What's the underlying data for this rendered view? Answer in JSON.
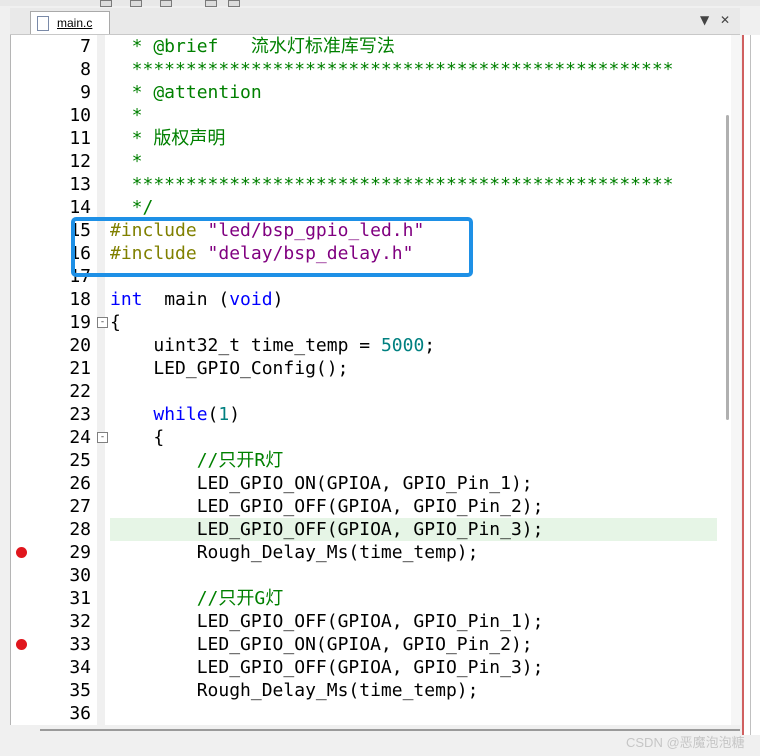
{
  "tab": {
    "filename": "main.c"
  },
  "tab_controls": {
    "dropdown": "▼",
    "close": "✕"
  },
  "watermark": "CSDN @恶魔泡泡糖",
  "lines": [
    {
      "n": "7",
      "segs": [
        [
          "cm",
          "  * @brief   流水灯标准库写法"
        ]
      ]
    },
    {
      "n": "8",
      "segs": [
        [
          "cm",
          "  **************************************************"
        ]
      ]
    },
    {
      "n": "9",
      "segs": [
        [
          "cm",
          "  * @attention"
        ]
      ]
    },
    {
      "n": "10",
      "segs": [
        [
          "cm",
          "  *"
        ]
      ]
    },
    {
      "n": "11",
      "segs": [
        [
          "cm",
          "  * 版权声明"
        ]
      ]
    },
    {
      "n": "12",
      "segs": [
        [
          "cm",
          "  *"
        ]
      ]
    },
    {
      "n": "13",
      "segs": [
        [
          "cm",
          "  **************************************************"
        ]
      ]
    },
    {
      "n": "14",
      "segs": [
        [
          "cm",
          "  */"
        ]
      ]
    },
    {
      "n": "15",
      "segs": [
        [
          "pp",
          "#include "
        ],
        [
          "str",
          "\"led/bsp_gpio_led.h\""
        ]
      ]
    },
    {
      "n": "16",
      "segs": [
        [
          "pp",
          "#include "
        ],
        [
          "str",
          "\"delay/bsp_delay.h\""
        ]
      ]
    },
    {
      "n": "17",
      "segs": []
    },
    {
      "n": "18",
      "segs": [
        [
          "kw",
          "int"
        ],
        [
          "",
          "  main ("
        ],
        [
          "kw",
          "void"
        ],
        [
          "",
          ")"
        ]
      ]
    },
    {
      "n": "19",
      "segs": [
        [
          "",
          "{"
        ]
      ],
      "fold": "-"
    },
    {
      "n": "20",
      "segs": [
        [
          "",
          "    uint32_t time_temp = "
        ],
        [
          "num",
          "5000"
        ],
        [
          "",
          ";"
        ]
      ]
    },
    {
      "n": "21",
      "segs": [
        [
          "",
          "    LED_GPIO_Config();"
        ]
      ]
    },
    {
      "n": "22",
      "segs": []
    },
    {
      "n": "23",
      "segs": [
        [
          "",
          "    "
        ],
        [
          "kw",
          "while"
        ],
        [
          "",
          "("
        ],
        [
          "num",
          "1"
        ],
        [
          "",
          ")"
        ]
      ]
    },
    {
      "n": "24",
      "segs": [
        [
          "",
          "    {"
        ]
      ],
      "fold": "-"
    },
    {
      "n": "25",
      "segs": [
        [
          "",
          "        "
        ],
        [
          "cm",
          "//只开R灯"
        ]
      ]
    },
    {
      "n": "26",
      "segs": [
        [
          "",
          "        LED_GPIO_ON(GPIOA, GPIO_Pin_1);"
        ]
      ]
    },
    {
      "n": "27",
      "segs": [
        [
          "",
          "        LED_GPIO_OFF(GPIOA, GPIO_Pin_2);"
        ]
      ]
    },
    {
      "n": "28",
      "segs": [
        [
          "",
          "        LED_GPIO_OFF(GPIOA, GPIO_Pin_3);"
        ]
      ],
      "current": true
    },
    {
      "n": "29",
      "segs": [
        [
          "",
          "        Rough_Delay_Ms(time_temp);"
        ]
      ],
      "breakpoint": true
    },
    {
      "n": "30",
      "segs": []
    },
    {
      "n": "31",
      "segs": [
        [
          "",
          "        "
        ],
        [
          "cm",
          "//只开G灯"
        ]
      ]
    },
    {
      "n": "32",
      "segs": [
        [
          "",
          "        LED_GPIO_OFF(GPIOA, GPIO_Pin_1);"
        ]
      ]
    },
    {
      "n": "33",
      "segs": [
        [
          "",
          "        LED_GPIO_ON(GPIOA, GPIO_Pin_2);"
        ]
      ],
      "breakpoint": true
    },
    {
      "n": "34",
      "segs": [
        [
          "",
          "        LED_GPIO_OFF(GPIOA, GPIO_Pin_3);"
        ]
      ]
    },
    {
      "n": "35",
      "segs": [
        [
          "",
          "        Rough_Delay_Ms(time_temp);"
        ]
      ]
    },
    {
      "n": "36",
      "segs": []
    }
  ]
}
